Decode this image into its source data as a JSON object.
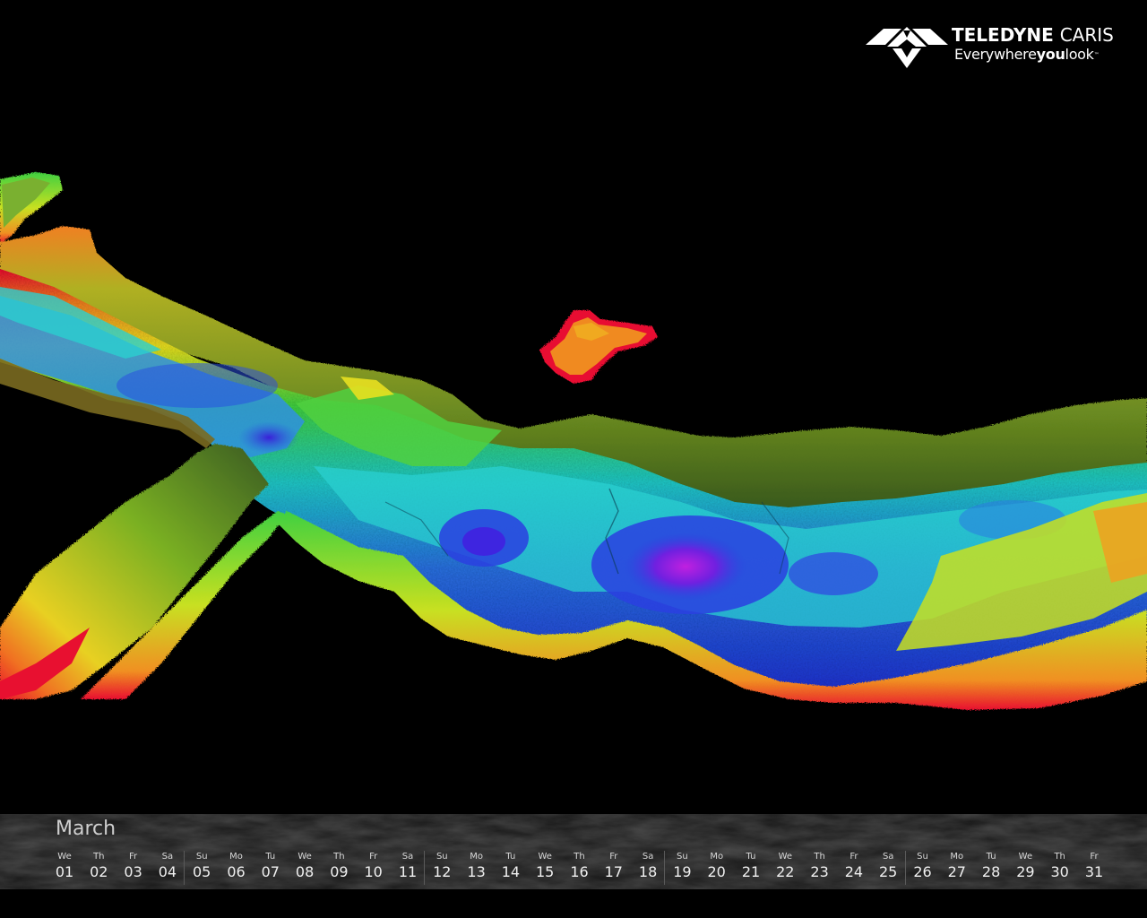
{
  "logo": {
    "company_bold": "TELEDYNE",
    "company_light": "CARIS",
    "tag_part1": "Everywhere",
    "tag_part2": "you",
    "tag_part3": "look",
    "tag_tm": "™",
    "mark_icon": "teledyne-chevron-icon"
  },
  "calendar": {
    "month": "March",
    "days": [
      {
        "name": "We",
        "num": "01"
      },
      {
        "name": "Th",
        "num": "02"
      },
      {
        "name": "Fr",
        "num": "03"
      },
      {
        "name": "Sa",
        "num": "04"
      },
      {
        "name": "Su",
        "num": "05"
      },
      {
        "name": "Mo",
        "num": "06"
      },
      {
        "name": "Tu",
        "num": "07"
      },
      {
        "name": "We",
        "num": "08"
      },
      {
        "name": "Th",
        "num": "09"
      },
      {
        "name": "Fr",
        "num": "10"
      },
      {
        "name": "Sa",
        "num": "11"
      },
      {
        "name": "Su",
        "num": "12"
      },
      {
        "name": "Mo",
        "num": "13"
      },
      {
        "name": "Tu",
        "num": "14"
      },
      {
        "name": "We",
        "num": "15"
      },
      {
        "name": "Th",
        "num": "16"
      },
      {
        "name": "Fr",
        "num": "17"
      },
      {
        "name": "Sa",
        "num": "18"
      },
      {
        "name": "Su",
        "num": "19"
      },
      {
        "name": "Mo",
        "num": "20"
      },
      {
        "name": "Tu",
        "num": "21"
      },
      {
        "name": "We",
        "num": "22"
      },
      {
        "name": "Th",
        "num": "23"
      },
      {
        "name": "Fr",
        "num": "24"
      },
      {
        "name": "Sa",
        "num": "25"
      },
      {
        "name": "Su",
        "num": "26"
      },
      {
        "name": "Mo",
        "num": "27"
      },
      {
        "name": "Tu",
        "num": "28"
      },
      {
        "name": "We",
        "num": "29"
      },
      {
        "name": "Th",
        "num": "30"
      },
      {
        "name": "Fr",
        "num": "31"
      }
    ]
  },
  "colors": {
    "background": "#000000",
    "deep": "#b000e0",
    "blue": "#2040e0",
    "cyan": "#20c8d8",
    "green": "#30d040",
    "yellow": "#e8e020",
    "orange": "#f08020",
    "red": "#e81030"
  }
}
